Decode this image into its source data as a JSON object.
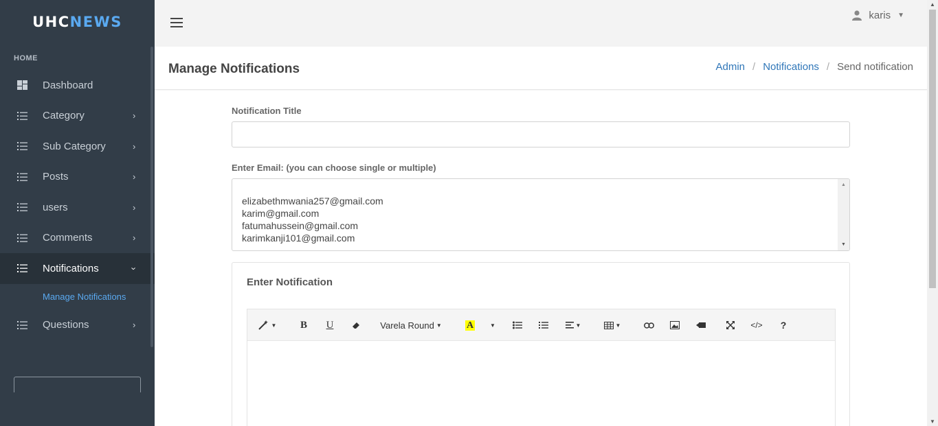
{
  "brand": {
    "part1": "UHC",
    "part2": "NEWS"
  },
  "sidebar": {
    "header": "HOME",
    "items": [
      {
        "label": "Dashboard",
        "icon": "dashboard-icon"
      },
      {
        "label": "Category",
        "icon": "list-icon"
      },
      {
        "label": "Sub Category",
        "icon": "list-icon"
      },
      {
        "label": "Posts",
        "icon": "list-icon"
      },
      {
        "label": "users",
        "icon": "list-icon"
      },
      {
        "label": "Comments",
        "icon": "list-icon"
      },
      {
        "label": "Notifications",
        "icon": "list-icon"
      },
      {
        "label": "Questions",
        "icon": "list-icon"
      }
    ],
    "sub_item": "Manage Notifications"
  },
  "topbar": {
    "user": "karis"
  },
  "page": {
    "title": "Manage Notifications",
    "breadcrumb": [
      "Admin",
      "Notifications",
      "Send notification"
    ]
  },
  "form": {
    "title_label": "Notification Title",
    "title_value": "",
    "email_label": "Enter Email: (you can choose single or multiple)",
    "emails": [
      "elizabethmwania257@gmail.com",
      "karim@gmail.com",
      "fatumahussein@gmail.com",
      "karimkanji101@gmail.com"
    ],
    "panel_title": "Enter Notification",
    "font_name": "Varela Round"
  },
  "colors": {
    "sidebar": "#323d48",
    "accent": "#5aa9f0",
    "link": "#2f76b8"
  }
}
